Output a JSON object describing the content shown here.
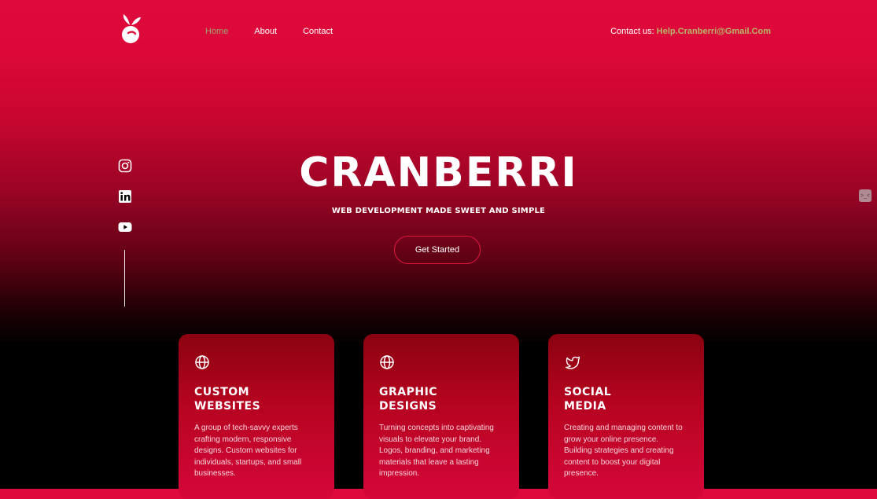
{
  "brand": {
    "logo_icon": "cranberry-logo-icon"
  },
  "nav": {
    "items": [
      {
        "label": "Home",
        "active": true
      },
      {
        "label": "About"
      },
      {
        "label": "Contact"
      }
    ]
  },
  "contact": {
    "label": "Contact us: ",
    "email": "Help.Cranberri@Gmail.Com"
  },
  "social": [
    {
      "icon": "instagram-icon"
    },
    {
      "icon": "linkedin-icon"
    },
    {
      "icon": "youtube-icon"
    }
  ],
  "hero": {
    "title": "CRANBERRI",
    "subtitle": "WEB DEVELOPMENT MADE SWEET AND SIMPLE",
    "cta": "Get Started"
  },
  "cards": [
    {
      "icon": "globe-icon",
      "title_line1": "CUSTOM",
      "title_line2": "WEBSITES",
      "text": "A group of tech-savvy experts crafting modern, responsive designs. Custom websites for individuals, startups, and small businesses."
    },
    {
      "icon": "globe-icon",
      "title_line1": "GRAPHIC",
      "title_line2": "DESIGNS",
      "text": "Turning concepts into captivating visuals to elevate your brand. Logos, branding, and marketing materials that leave a lasting impression."
    },
    {
      "icon": "twitter-icon",
      "title_line1": "SOCIAL",
      "title_line2": "MEDIA",
      "text": "Creating and managing content to grow your online presence. Building strategies and creating content to boost your digital presence."
    }
  ],
  "colors": {
    "accent": "#de0a3c",
    "nav_active": "#9ca86f",
    "email": "#b5b86a"
  }
}
